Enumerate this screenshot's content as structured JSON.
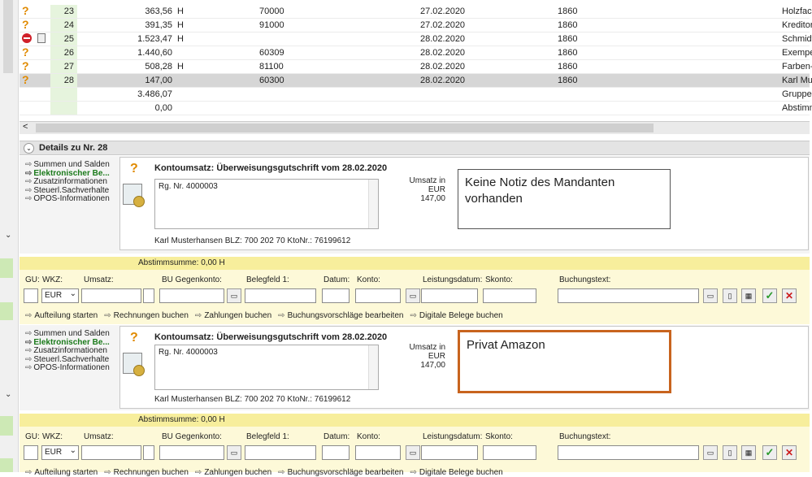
{
  "table": {
    "rows": [
      {
        "nr": "23",
        "betrag": "363,56",
        "sh": "H",
        "gegenkonto": "70000",
        "datum": "27.02.2020",
        "konto": "1860",
        "text": "Holzfach",
        "icon": "question-icon"
      },
      {
        "nr": "24",
        "betrag": "391,35",
        "sh": "H",
        "gegenkonto": "91000",
        "datum": "27.02.2020",
        "konto": "1860",
        "text": "Kreditort",
        "icon": "question-icon"
      },
      {
        "nr": "25",
        "betrag": "1.523,47",
        "sh": "H",
        "gegenkonto": "",
        "datum": "28.02.2020",
        "konto": "1860",
        "text": "Schmidt,",
        "icon": "stop-icon"
      },
      {
        "nr": "26",
        "betrag": "1.440,60",
        "sh": "",
        "gegenkonto": "60309",
        "datum": "28.02.2020",
        "konto": "1860",
        "text": "Exempel",
        "icon": "question-icon"
      },
      {
        "nr": "27",
        "betrag": "508,28",
        "sh": "H",
        "gegenkonto": "81100",
        "datum": "28.02.2020",
        "konto": "1860",
        "text": "Farben-F",
        "icon": "question-icon"
      },
      {
        "nr": "28",
        "betrag": "147,00",
        "sh": "",
        "gegenkonto": "60300",
        "datum": "28.02.2020",
        "konto": "1860",
        "text": "Karl Mus",
        "icon": "question-icon"
      }
    ],
    "sum1": {
      "betrag": "3.486,07",
      "text": "Gruppen"
    },
    "sum2": {
      "betrag": "0,00",
      "text": "Abstimm"
    },
    "scroll_left": "<"
  },
  "details_header": "Details zu Nr. 28",
  "nav": {
    "items": [
      "Summen und Salden",
      "Elektronischer Be...",
      "Zusatzinformationen",
      "Steuerl.Sachverhalte",
      "OPOS-Informationen"
    ]
  },
  "panels": [
    {
      "kontoumsatz": "Kontoumsatz: Überweisungsgutschrift vom 28.02.2020",
      "note": "Rg. Nr. 4000003",
      "umsatz_label": "Umsatz in EUR",
      "umsatz_value": "147,00",
      "footer": "Karl Musterhansen   BLZ: 700 202 70   KtoNr.: 76199612",
      "notiz": "Keine Notiz des Mandanten vorhanden"
    },
    {
      "kontoumsatz": "Kontoumsatz: Überweisungsgutschrift vom 28.02.2020",
      "note": "Rg. Nr. 4000003",
      "umsatz_label": "Umsatz in EUR",
      "umsatz_value": "147,00",
      "footer": "Karl Musterhansen   BLZ: 700 202 70   KtoNr.: 76199612",
      "notiz": "Privat Amazon"
    }
  ],
  "buchung": {
    "abstimmsumme": "Abstimmsumme: 0,00 H",
    "labels": {
      "gu": "GU:",
      "wkz": "WKZ:",
      "umsatz": "Umsatz:",
      "bu_gegenkonto": "BU Gegenkonto:",
      "belegfeld": "Belegfeld 1:",
      "datum": "Datum:",
      "konto": "Konto:",
      "leistungsdatum": "Leistungsdatum:",
      "skonto": "Skonto:",
      "buchungstext": "Buchungstext:"
    },
    "wkz_value": "EUR",
    "links": [
      "Aufteilung starten",
      "Rechnungen buchen",
      "Zahlungen buchen",
      "Buchungsvorschläge bearbeiten",
      "Digitale Belege buchen"
    ],
    "ok": "✓",
    "cancel": "✕"
  },
  "colors": {
    "highlight_border": "#c8641e",
    "green_label": "#1a7a1a",
    "yellow_bar": "#f7ee9c"
  }
}
